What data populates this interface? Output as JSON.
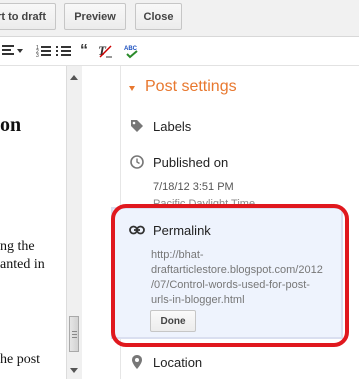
{
  "toolbar": {
    "revert_label": "rt to draft",
    "preview_label": "Preview",
    "close_label": "Close"
  },
  "format_toolbar": {
    "icons": [
      "align-icon",
      "numbered-list-icon",
      "bulleted-list-icon",
      "quote-icon",
      "remove-format-icon",
      "spellcheck-icon"
    ],
    "spellcheck_label": "ABC"
  },
  "editor": {
    "heading_fragment": "on",
    "lines": [
      "ng the",
      "anted in",
      "he post"
    ]
  },
  "sidebar": {
    "title": "Post settings",
    "labels": "Labels",
    "published_on": "Published on",
    "published_date": "7/18/12 3:51 PM",
    "published_tz": "Pacific Daylight Time",
    "permalink": {
      "title": "Permalink",
      "url_line1": "http://bhat-",
      "url_line2": "draftarticlestore.blogspot.com/2012",
      "url_line3": "/07/Control-words-used-for-post-",
      "url_line4": "urls-in-blogger.html",
      "done_label": "Done"
    },
    "location": "Location"
  },
  "colors": {
    "accent": "#e8782f",
    "highlight": "#e0181e",
    "permalink_bg": "#eef3fd"
  }
}
